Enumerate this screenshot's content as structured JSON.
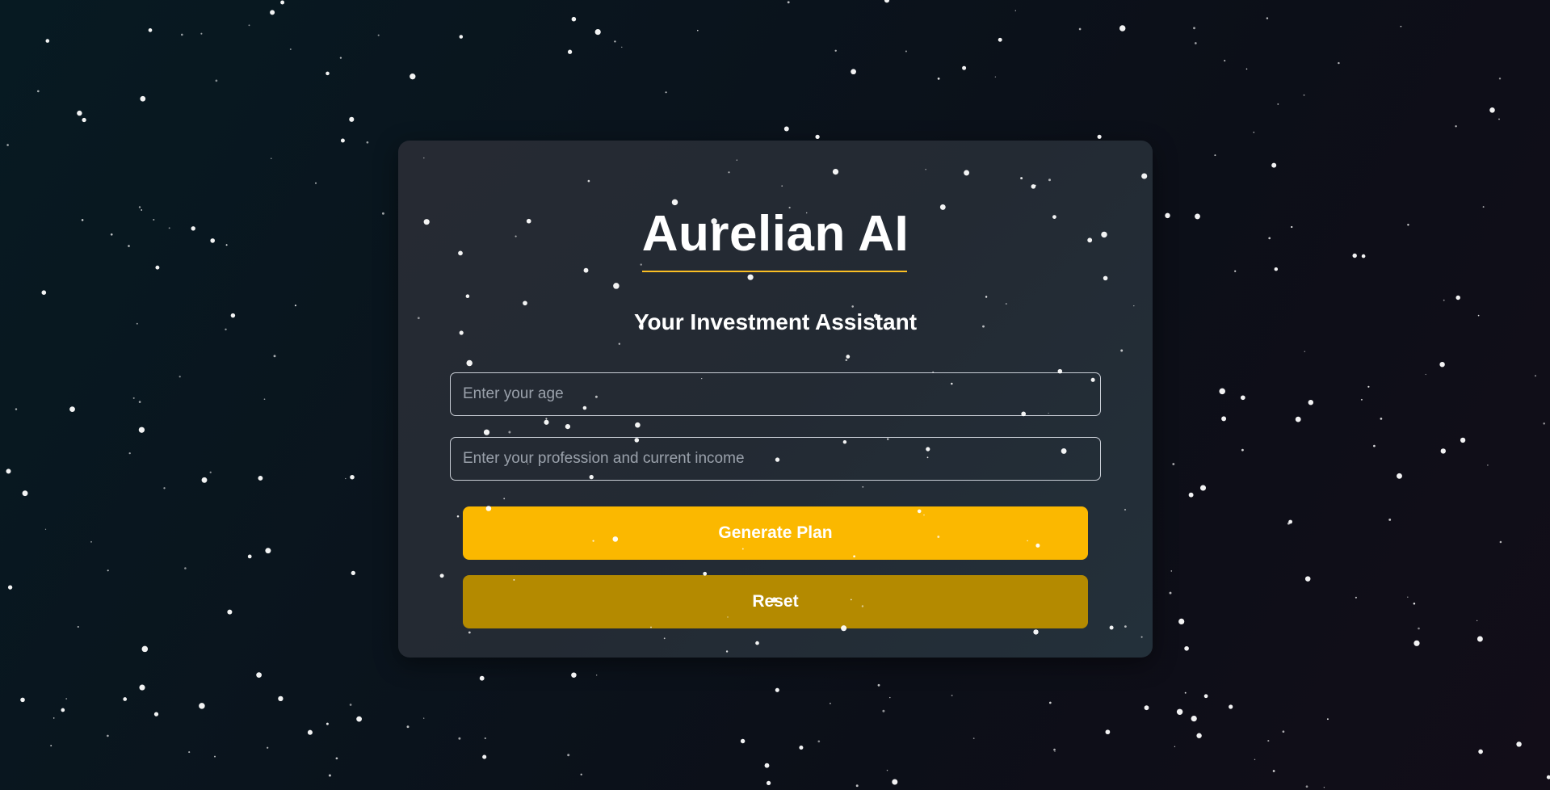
{
  "app": {
    "title": "Aurelian AI",
    "subtitle": "Your Investment Assistant"
  },
  "form": {
    "age": {
      "placeholder": "Enter your age",
      "value": ""
    },
    "profession": {
      "placeholder": "Enter your profession and current income",
      "value": ""
    }
  },
  "buttons": {
    "generate_label": "Generate Plan",
    "reset_label": "Reset"
  },
  "colors": {
    "accent": "#fbb800",
    "accent_dark": "#b48a00",
    "underline": "#fbbf24",
    "card_bg": "#252b34",
    "text": "#ffffff"
  }
}
